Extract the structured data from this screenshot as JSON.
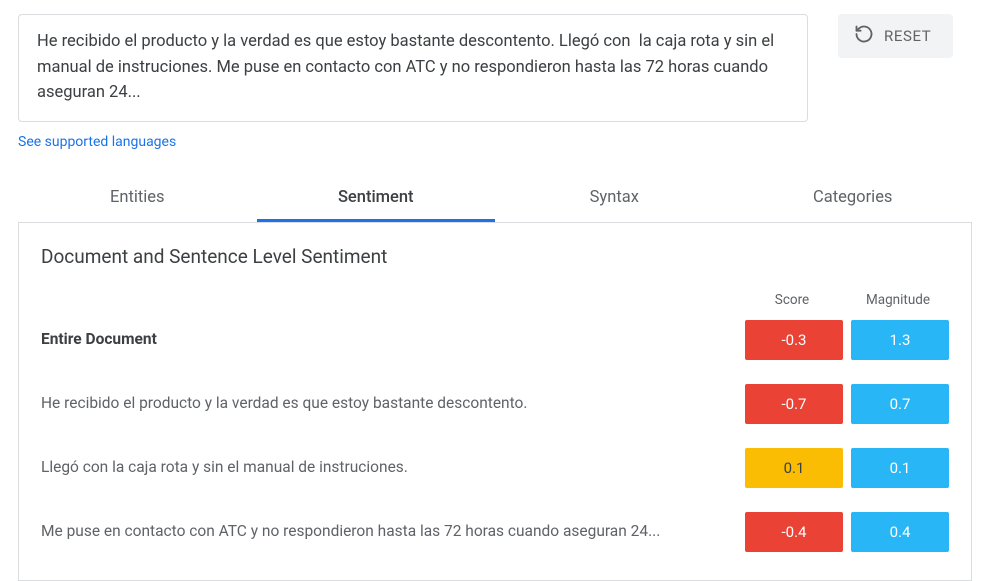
{
  "input_text": "He recibido el producto y la verdad es que estoy bastante descontento. Llegó con  la caja rota y sin el manual de instruciones. Me puse en contacto con ATC y no respondieron hasta las 72 horas cuando aseguran 24...",
  "reset_label": "RESET",
  "languages_link": "See supported languages",
  "tabs": {
    "entities": "Entities",
    "sentiment": "Sentiment",
    "syntax": "Syntax",
    "categories": "Categories"
  },
  "panel": {
    "title": "Document and Sentence Level Sentiment",
    "score_header": "Score",
    "magnitude_header": "Magnitude",
    "rows": [
      {
        "label": "Entire Document",
        "bold": true,
        "score": "-0.3",
        "score_class": "neg",
        "magnitude": "1.3"
      },
      {
        "label": "He recibido el producto y la verdad es que estoy bastante descontento.",
        "bold": false,
        "score": "-0.7",
        "score_class": "neg",
        "magnitude": "0.7"
      },
      {
        "label": "Llegó con la caja rota y sin el manual de instruciones.",
        "bold": false,
        "score": "0.1",
        "score_class": "neu",
        "magnitude": "0.1"
      },
      {
        "label": "Me puse en contacto con ATC y no respondieron hasta las 72 horas cuando aseguran 24...",
        "bold": false,
        "score": "-0.4",
        "score_class": "neg",
        "magnitude": "0.4"
      }
    ]
  }
}
